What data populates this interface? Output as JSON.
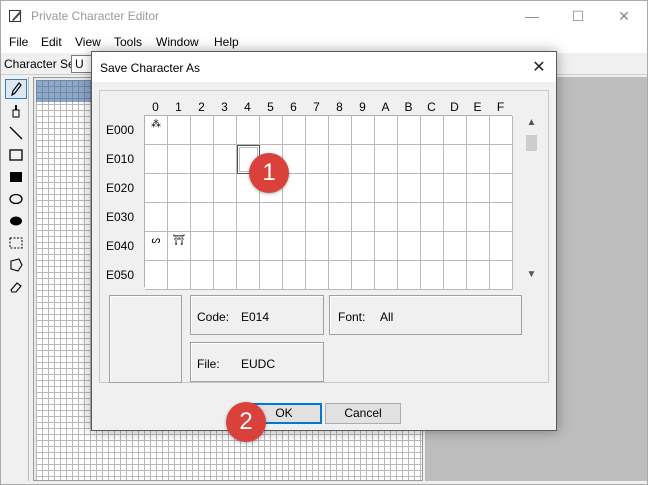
{
  "app": {
    "title": "Private Character Editor",
    "menu": [
      "File",
      "Edit",
      "View",
      "Tools",
      "Window",
      "Help"
    ],
    "charset_label": "Character Set:",
    "charset_value": "U",
    "window_controls": [
      "minimize-icon",
      "maximize-icon",
      "close-icon"
    ]
  },
  "tools": [
    "pencil-icon",
    "brush-icon",
    "line-icon",
    "hollow-rectangle-icon",
    "filled-rectangle-icon",
    "hollow-ellipse-icon",
    "filled-ellipse-icon",
    "rect-select-icon",
    "freeform-select-icon",
    "eraser-icon"
  ],
  "dialog": {
    "title": "Save Character As",
    "close_glyph": "✕",
    "columns": [
      "0",
      "1",
      "2",
      "3",
      "4",
      "5",
      "6",
      "7",
      "8",
      "9",
      "A",
      "B",
      "C",
      "D",
      "E",
      "F"
    ],
    "rows": [
      "E000",
      "E010",
      "E020",
      "E030",
      "E040",
      "E050"
    ],
    "glyphs": {
      "E000": "⁂",
      "E040": "ᔕ",
      "E041": "⛩"
    },
    "selected_code": "E014",
    "code_label": "Code:",
    "code_value": "E014",
    "font_label": "Font:",
    "font_value": "All",
    "file_label": "File:",
    "file_value": "EUDC",
    "ok_label": "OK",
    "cancel_label": "Cancel"
  },
  "markers": [
    "1",
    "2"
  ],
  "colors": {
    "marker": "#d9413a",
    "default_button_border": "#0078d7",
    "edit_band": "#8fa8c8"
  }
}
